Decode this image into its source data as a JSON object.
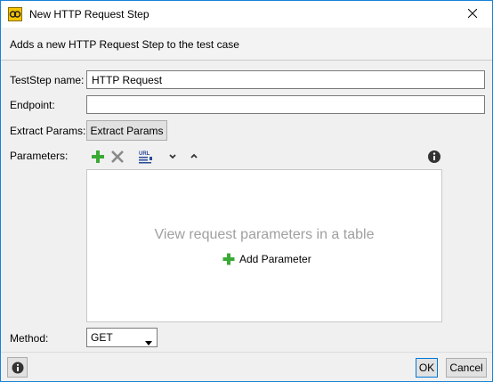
{
  "window": {
    "title": "New HTTP Request Step"
  },
  "header": {
    "description": "Adds a new HTTP Request Step to the test case"
  },
  "form": {
    "teststep_name_label": "TestStep name:",
    "teststep_name_value": "HTTP Request",
    "endpoint_label": "Endpoint:",
    "endpoint_value": "",
    "extract_params_label": "Extract Params:",
    "extract_params_button": "Extract Params",
    "parameters_label": "Parameters:",
    "parameters_empty_message": "View request parameters in a table",
    "add_parameter_label": "Add Parameter",
    "method_label": "Method:",
    "method_value": "GET",
    "url_icon_text": "URL"
  },
  "footer": {
    "ok_label": "OK",
    "cancel_label": "Cancel"
  },
  "icons": {
    "app": "soapui-app-icon",
    "close": "close-icon",
    "add": "plus-icon",
    "delete": "x-icon",
    "url_params": "url-params-icon",
    "move_down": "chevron-down-icon",
    "move_up": "chevron-up-icon",
    "info": "info-icon",
    "help": "info-icon"
  },
  "colors": {
    "accent_border": "#1883d7",
    "add_green": "#3aaa35",
    "delete_gray": "#8a8a8a",
    "placeholder_gray": "#a0a0a0"
  }
}
